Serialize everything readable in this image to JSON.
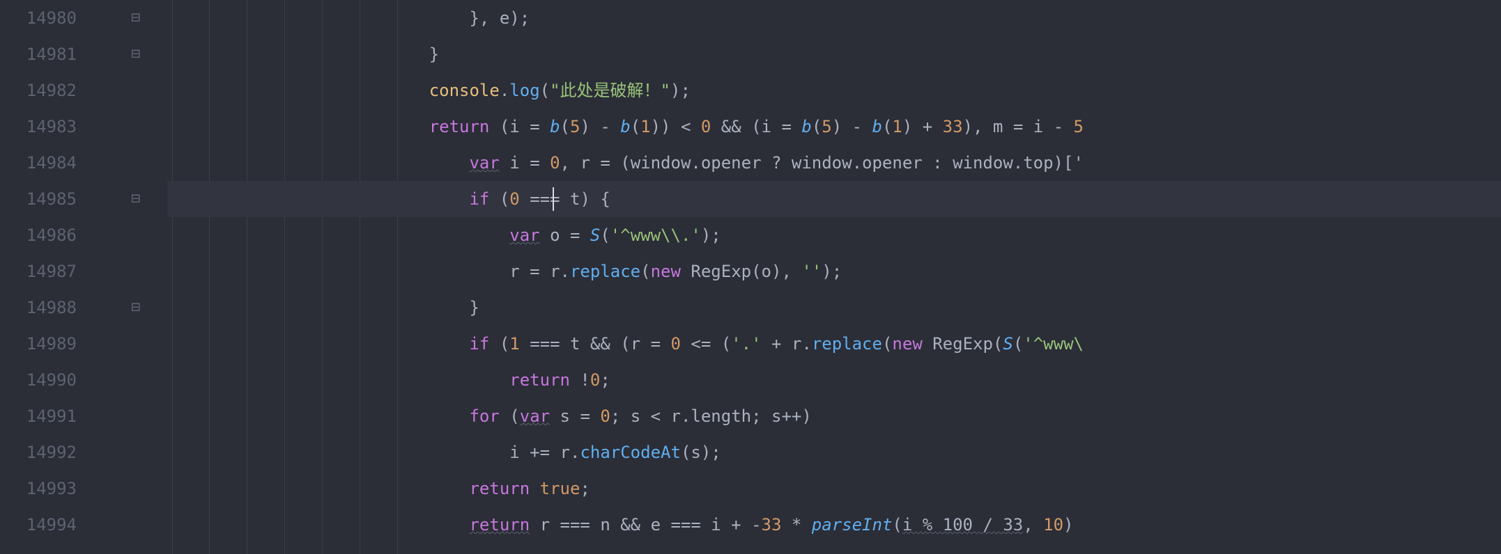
{
  "editor": {
    "activeLineIndex": 5,
    "caret": {
      "lineIndex": 5,
      "leftPx": 553
    },
    "indentGuidesPx": [
      7,
      60,
      114,
      168,
      222,
      276,
      330
    ],
    "gutter": {
      "start": 14980,
      "lines": [
        "14980",
        "14981",
        "14982",
        "14983",
        "14984",
        "14985",
        "14986",
        "14987",
        "14988",
        "14989",
        "14990",
        "14991",
        "14992",
        "14993",
        "14994"
      ]
    },
    "foldMarks": {
      "0": "⊟",
      "1": "⊟",
      "5": "⊟",
      "8": "⊟"
    },
    "code": [
      {
        "indent": "                              ",
        "tokens": [
          {
            "t": "}, e);",
            "c": "tk-default"
          }
        ]
      },
      {
        "indent": "                          ",
        "tokens": [
          {
            "t": "}",
            "c": "tk-default"
          }
        ]
      },
      {
        "indent": "                          ",
        "tokens": [
          {
            "t": "console",
            "c": "tk-ident"
          },
          {
            "t": ".",
            "c": "tk-punct"
          },
          {
            "t": "log",
            "c": "tk-func"
          },
          {
            "t": "(",
            "c": "tk-punct"
          },
          {
            "t": "\"此处是破解！\"",
            "c": "tk-string"
          },
          {
            "t": ");",
            "c": "tk-punct"
          }
        ]
      },
      {
        "indent": "                          ",
        "tokens": [
          {
            "t": "return",
            "c": "tk-keyword"
          },
          {
            "t": " (i = ",
            "c": "tk-default"
          },
          {
            "t": "b",
            "c": "tk-func-i"
          },
          {
            "t": "(",
            "c": "tk-punct"
          },
          {
            "t": "5",
            "c": "tk-number"
          },
          {
            "t": ") - ",
            "c": "tk-default"
          },
          {
            "t": "b",
            "c": "tk-func-i"
          },
          {
            "t": "(",
            "c": "tk-punct"
          },
          {
            "t": "1",
            "c": "tk-number"
          },
          {
            "t": ")) < ",
            "c": "tk-default"
          },
          {
            "t": "0",
            "c": "tk-number"
          },
          {
            "t": " && (i = ",
            "c": "tk-default"
          },
          {
            "t": "b",
            "c": "tk-func-i"
          },
          {
            "t": "(",
            "c": "tk-punct"
          },
          {
            "t": "5",
            "c": "tk-number"
          },
          {
            "t": ") - ",
            "c": "tk-default"
          },
          {
            "t": "b",
            "c": "tk-func-i"
          },
          {
            "t": "(",
            "c": "tk-punct"
          },
          {
            "t": "1",
            "c": "tk-number"
          },
          {
            "t": ") + ",
            "c": "tk-default"
          },
          {
            "t": "33",
            "c": "tk-number"
          },
          {
            "t": "), m = i - ",
            "c": "tk-default"
          },
          {
            "t": "5",
            "c": "tk-number"
          }
        ]
      },
      {
        "indent": "                              ",
        "tokens": [
          {
            "t": "var",
            "c": "tk-keyword-u"
          },
          {
            "t": " i = ",
            "c": "tk-default"
          },
          {
            "t": "0",
            "c": "tk-number"
          },
          {
            "t": ", r = (window.opener ? window.opener : window.top)['",
            "c": "tk-default"
          }
        ]
      },
      {
        "indent": "                              ",
        "tokens": [
          {
            "t": "if",
            "c": "tk-keyword"
          },
          {
            "t": " (",
            "c": "tk-default"
          },
          {
            "t": "0",
            "c": "tk-number"
          },
          {
            "t": " === t) {",
            "c": "tk-default"
          }
        ]
      },
      {
        "indent": "                                  ",
        "tokens": [
          {
            "t": "var",
            "c": "tk-keyword-u"
          },
          {
            "t": " o = ",
            "c": "tk-default"
          },
          {
            "t": "S",
            "c": "tk-func-i"
          },
          {
            "t": "(",
            "c": "tk-punct"
          },
          {
            "t": "'^www\\\\.'",
            "c": "tk-string"
          },
          {
            "t": ");",
            "c": "tk-punct"
          }
        ]
      },
      {
        "indent": "                                  ",
        "tokens": [
          {
            "t": "r = r.",
            "c": "tk-default"
          },
          {
            "t": "replace",
            "c": "tk-func"
          },
          {
            "t": "(",
            "c": "tk-punct"
          },
          {
            "t": "new",
            "c": "tk-keyword"
          },
          {
            "t": " RegExp(o), ",
            "c": "tk-default"
          },
          {
            "t": "''",
            "c": "tk-string"
          },
          {
            "t": ");",
            "c": "tk-punct"
          }
        ]
      },
      {
        "indent": "                              ",
        "tokens": [
          {
            "t": "}",
            "c": "tk-default"
          }
        ]
      },
      {
        "indent": "                              ",
        "tokens": [
          {
            "t": "if",
            "c": "tk-keyword"
          },
          {
            "t": " (",
            "c": "tk-default"
          },
          {
            "t": "1",
            "c": "tk-number"
          },
          {
            "t": " === t && (r = ",
            "c": "tk-default"
          },
          {
            "t": "0",
            "c": "tk-number"
          },
          {
            "t": " <= (",
            "c": "tk-default"
          },
          {
            "t": "'.'",
            "c": "tk-string"
          },
          {
            "t": " + r.",
            "c": "tk-default"
          },
          {
            "t": "replace",
            "c": "tk-func"
          },
          {
            "t": "(",
            "c": "tk-punct"
          },
          {
            "t": "new",
            "c": "tk-keyword"
          },
          {
            "t": " RegExp(",
            "c": "tk-default"
          },
          {
            "t": "S",
            "c": "tk-func-i"
          },
          {
            "t": "(",
            "c": "tk-punct"
          },
          {
            "t": "'^www\\",
            "c": "tk-string"
          }
        ]
      },
      {
        "indent": "                                  ",
        "tokens": [
          {
            "t": "return",
            "c": "tk-keyword"
          },
          {
            "t": " !",
            "c": "tk-default"
          },
          {
            "t": "0",
            "c": "tk-number"
          },
          {
            "t": ";",
            "c": "tk-punct"
          }
        ]
      },
      {
        "indent": "                              ",
        "tokens": [
          {
            "t": "for",
            "c": "tk-keyword"
          },
          {
            "t": " (",
            "c": "tk-default"
          },
          {
            "t": "var",
            "c": "tk-keyword-u"
          },
          {
            "t": " s = ",
            "c": "tk-default"
          },
          {
            "t": "0",
            "c": "tk-number"
          },
          {
            "t": "; s < r.length; s++)",
            "c": "tk-default"
          }
        ]
      },
      {
        "indent": "                                  ",
        "tokens": [
          {
            "t": "i += r.",
            "c": "tk-default"
          },
          {
            "t": "charCodeAt",
            "c": "tk-func"
          },
          {
            "t": "(s);",
            "c": "tk-punct"
          }
        ]
      },
      {
        "indent": "                              ",
        "tokens": [
          {
            "t": "return",
            "c": "tk-keyword"
          },
          {
            "t": " ",
            "c": "tk-default"
          },
          {
            "t": "true",
            "c": "tk-bool"
          },
          {
            "t": ";",
            "c": "tk-punct"
          }
        ]
      },
      {
        "indent": "                              ",
        "tokens": [
          {
            "t": "return",
            "c": "tk-keyword-u"
          },
          {
            "t": " r === n && e === i + -",
            "c": "tk-default"
          },
          {
            "t": "33",
            "c": "tk-number"
          },
          {
            "t": " * ",
            "c": "tk-default"
          },
          {
            "t": "parseInt",
            "c": "tk-func-i"
          },
          {
            "t": "(",
            "c": "tk-punct"
          },
          {
            "t": "i % 100 / 33",
            "c": "tk-default tk-wavy"
          },
          {
            "t": ", ",
            "c": "tk-default"
          },
          {
            "t": "10",
            "c": "tk-number"
          },
          {
            "t": ")",
            "c": "tk-punct"
          }
        ]
      }
    ]
  }
}
